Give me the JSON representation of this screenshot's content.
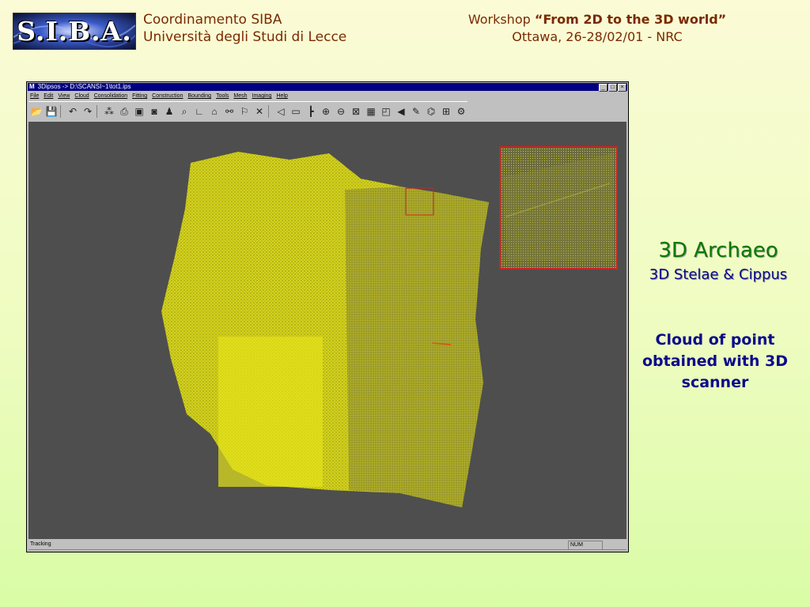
{
  "header": {
    "logo_text": "S.I.B.A.",
    "org_line1": "Coordinamento SIBA",
    "org_line2": "Università degli Studi di Lecce",
    "workshop_prefix": "Workshop ",
    "workshop_title": "“From 2D to the 3D world”",
    "workshop_details": "Ottawa, 26-28/02/01 - NRC"
  },
  "window": {
    "app_icon": "M",
    "title": "3Dipsos -> D:\\SCANSI~1\\tot1.ips",
    "controls": {
      "minimize": "_",
      "maximize": "□",
      "close": "×"
    },
    "menu": [
      "File",
      "Edit",
      "View",
      "Cloud",
      "Consolidation",
      "Fitting",
      "Construction",
      "Bounding",
      "Tools",
      "Mesh",
      "Imaging",
      "Help"
    ],
    "toolbar_icons": [
      "open-icon",
      "save-icon",
      "undo-icon",
      "redo-icon",
      "cloud-icon",
      "print-icon",
      "view-icon",
      "camera-icon",
      "pointer-icon",
      "zoom-icon",
      "axes-icon",
      "lock-icon",
      "link-icon",
      "select-icon",
      "delete-icon",
      "rotate-icon",
      "fit-icon",
      "pan-icon",
      "zoom-in-icon",
      "zoom-out-icon",
      "mesh-icon",
      "surface-icon",
      "render-icon",
      "light-icon",
      "measure-icon",
      "scan-icon",
      "grid-icon",
      "settings-icon"
    ],
    "status_text": "Tracking",
    "status_num": "NUM"
  },
  "panel": {
    "title": "3D Archaeo",
    "subtitle": "3D Stelae & Cippus",
    "caption": "Cloud of point obtained with 3D scanner"
  },
  "colors": {
    "point_cloud": "#e5e31a",
    "viewport_bg": "#4e4e4e",
    "selection_box": "#cc2222",
    "title_green": "#0a7a00",
    "text_navy": "#0a0a8c"
  }
}
